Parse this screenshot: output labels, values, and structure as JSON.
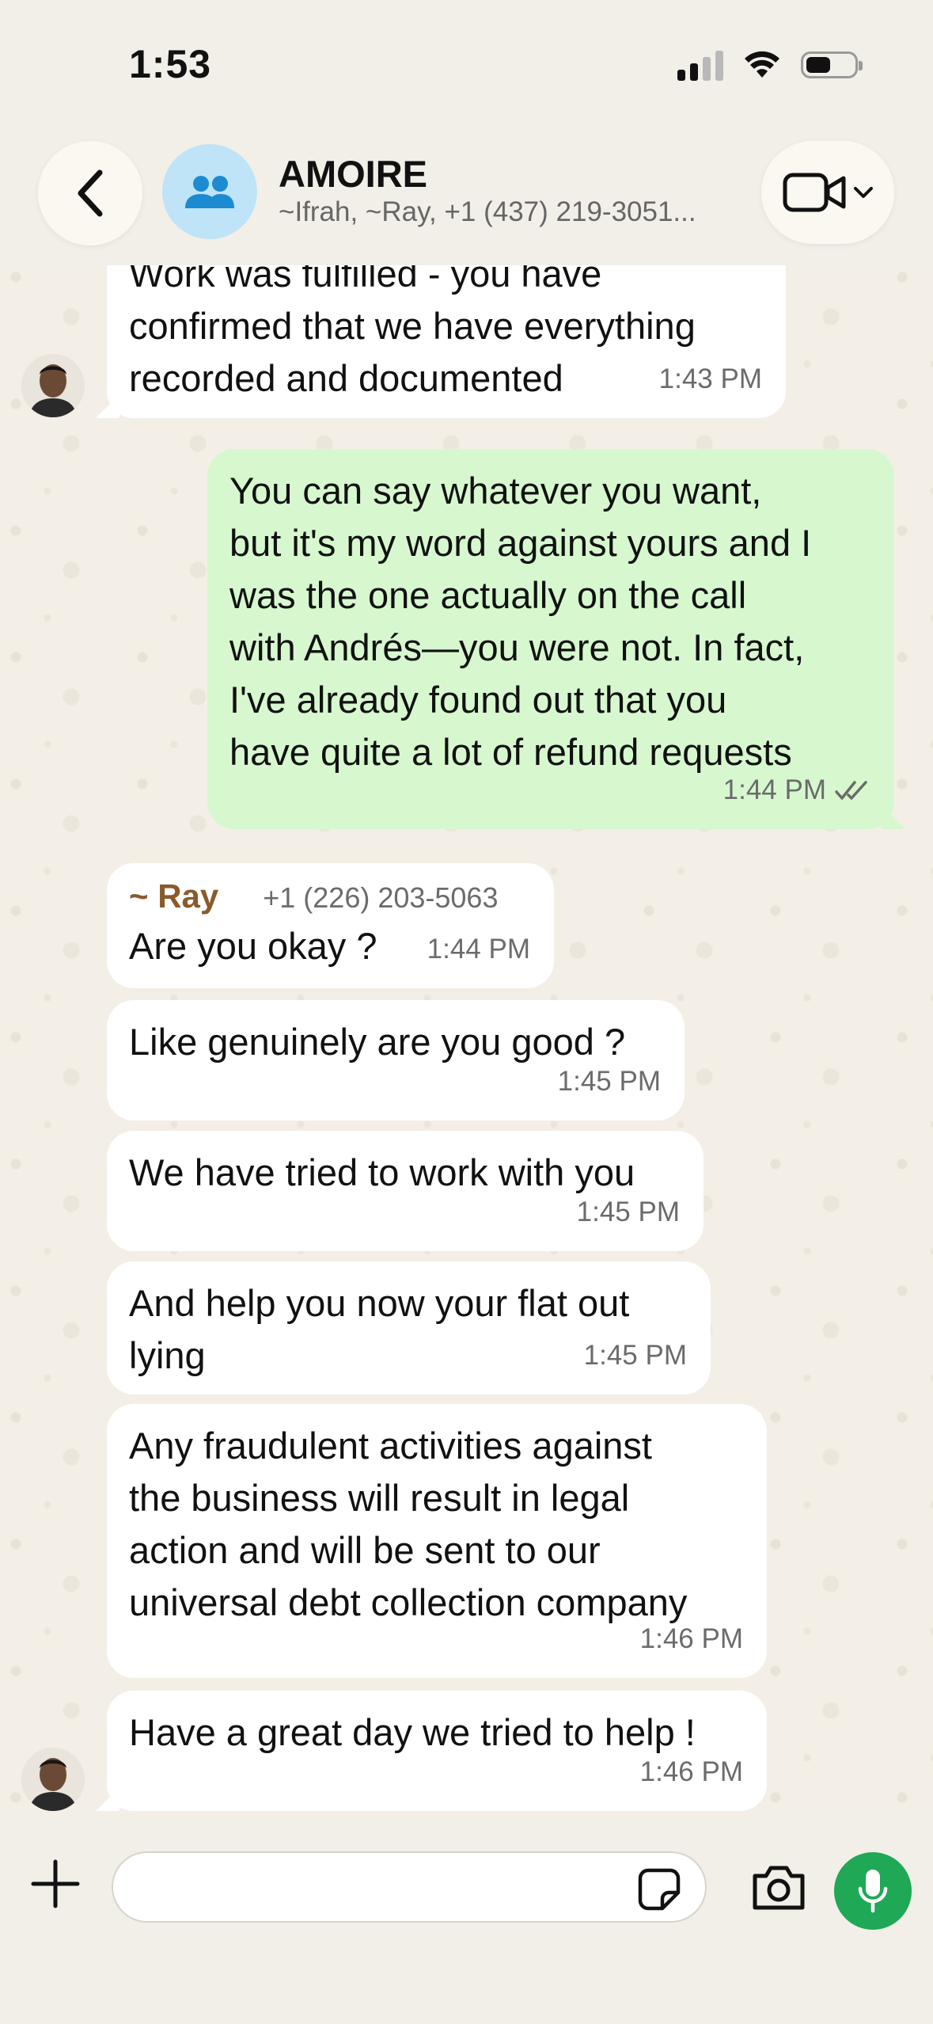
{
  "status": {
    "time": "1:53"
  },
  "header": {
    "title": "AMOIRE",
    "subtitle": "~Ifrah, ~Ray, +1 (437) 219-3051..."
  },
  "messages": [
    {
      "text": "Work was fulfilled - you have\nconfirmed that we have everything\nrecorded and documented",
      "time": "1:43 PM"
    },
    {
      "text": "You can say whatever you want,\nbut it's my word against yours and I\nwas the one actually on the call\nwith Andrés—you were not. In fact,\nI've already found out that you\nhave quite a lot of refund requests",
      "time": "1:44 PM"
    },
    {
      "sender": "~ Ray",
      "phone": "+1 (226) 203-5063",
      "text": "Are you okay ?",
      "time": "1:44 PM"
    },
    {
      "text": "Like genuinely are you good ?",
      "time": "1:45 PM"
    },
    {
      "text": "We have tried to work with you",
      "time": "1:45 PM"
    },
    {
      "text": "And help you now your flat out\nlying",
      "time": "1:45 PM"
    },
    {
      "text": "Any fraudulent activities against\nthe business will result in legal\naction and will be sent to our\nuniversal debt collection company",
      "time": "1:46 PM"
    },
    {
      "text": "Have a great day we tried to help !",
      "time": "1:46 PM"
    }
  ],
  "composer": {
    "value": ""
  },
  "colors": {
    "accent": "#1fa855",
    "outgoing": "#d7f8cf",
    "incoming": "#ffffff",
    "sender_name": "#8a5a2b"
  },
  "icons": [
    "chevron-left-icon",
    "group-icon",
    "video-camera-icon",
    "chevron-down-icon",
    "read-receipt-icon",
    "plus-icon",
    "sticker-icon",
    "camera-icon",
    "microphone-icon"
  ]
}
